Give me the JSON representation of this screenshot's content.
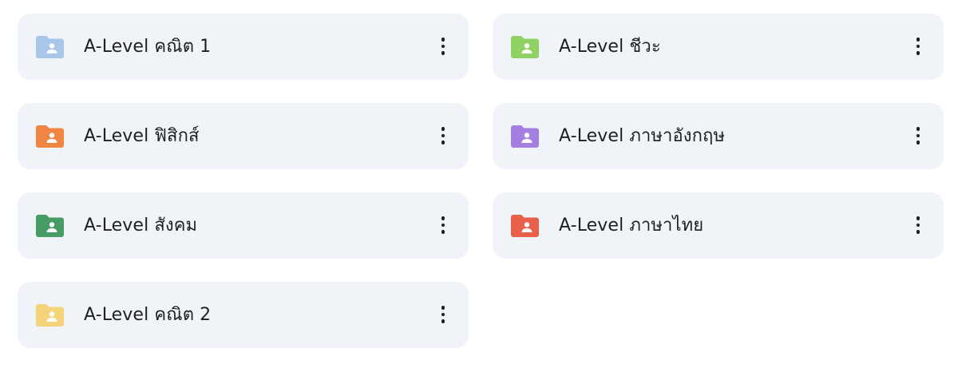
{
  "folders": [
    {
      "name": "A-Level คณิต 1",
      "color": "#a8c7e8",
      "icon": "shared-folder-icon"
    },
    {
      "name": "A-Level ชีวะ",
      "color": "#8fd162",
      "icon": "shared-folder-icon"
    },
    {
      "name": "A-Level ฟิสิกส์",
      "color": "#f08443",
      "icon": "shared-folder-icon"
    },
    {
      "name": "A-Level ภาษาอังกฤษ",
      "color": "#a47fe0",
      "icon": "shared-folder-icon"
    },
    {
      "name": "A-Level สังคม",
      "color": "#479c66",
      "icon": "shared-folder-icon"
    },
    {
      "name": "A-Level ภาษาไทย",
      "color": "#e8604a",
      "icon": "shared-folder-icon"
    },
    {
      "name": "A-Level คณิต 2",
      "color": "#f4d37a",
      "icon": "shared-folder-icon"
    }
  ],
  "more_icon": "more-vert-icon"
}
